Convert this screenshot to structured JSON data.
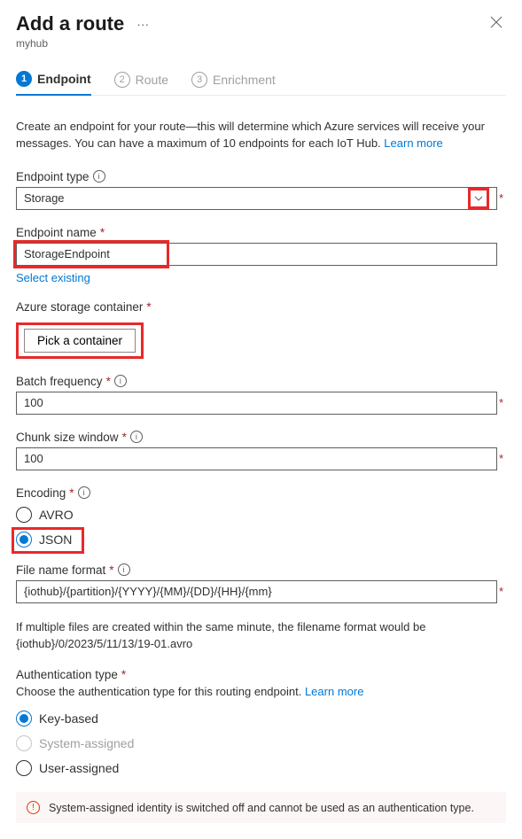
{
  "header": {
    "title": "Add a route",
    "subtitle": "myhub"
  },
  "steps": [
    {
      "num": "1",
      "label": "Endpoint",
      "active": true
    },
    {
      "num": "2",
      "label": "Route",
      "active": false
    },
    {
      "num": "3",
      "label": "Enrichment",
      "active": false
    }
  ],
  "intro": {
    "text": "Create an endpoint for your route—this will determine which Azure services will receive your messages. You can have a maximum of 10 endpoints for each IoT Hub. ",
    "link": "Learn more"
  },
  "endpoint_type": {
    "label": "Endpoint type",
    "value": "Storage"
  },
  "endpoint_name": {
    "label": "Endpoint name",
    "value": "StorageEndpoint",
    "select_existing": "Select existing"
  },
  "storage_container": {
    "label": "Azure storage container",
    "button": "Pick a container"
  },
  "batch_frequency": {
    "label": "Batch frequency",
    "value": "100"
  },
  "chunk_size": {
    "label": "Chunk size window",
    "value": "100"
  },
  "encoding": {
    "label": "Encoding",
    "options": [
      {
        "label": "AVRO",
        "selected": false
      },
      {
        "label": "JSON",
        "selected": true
      }
    ]
  },
  "file_format": {
    "label": "File name format",
    "value": "{iothub}/{partition}/{YYYY}/{MM}/{DD}/{HH}/{mm}"
  },
  "file_note": "If multiple files are created within the same minute, the filename format would be {iothub}/0/2023/5/11/13/19-01.avro",
  "auth": {
    "label": "Authentication type",
    "desc": "Choose the authentication type for this routing endpoint. ",
    "link": "Learn more",
    "options": [
      {
        "label": "Key-based",
        "selected": true,
        "disabled": false
      },
      {
        "label": "System-assigned",
        "selected": false,
        "disabled": true
      },
      {
        "label": "User-assigned",
        "selected": false,
        "disabled": false
      }
    ]
  },
  "warning": "System-assigned identity is switched off and cannot be used as an authentication type."
}
